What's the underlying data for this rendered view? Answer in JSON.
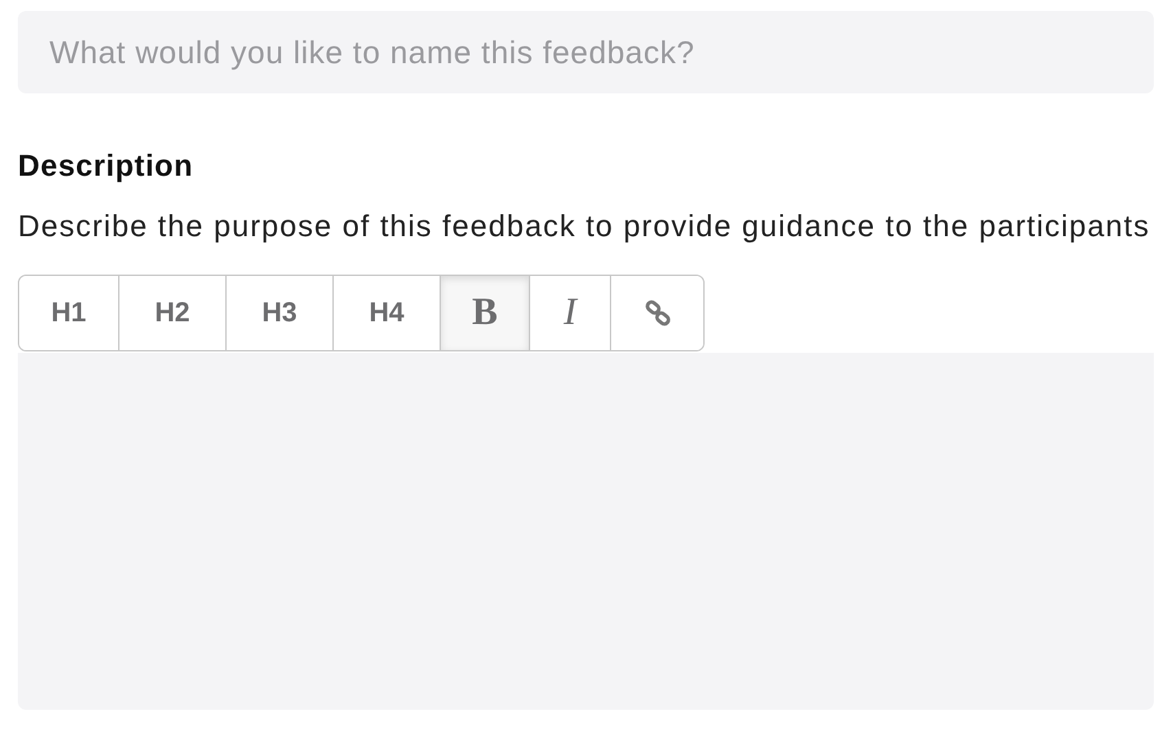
{
  "title_field": {
    "placeholder": "What would you like to name this feedback?"
  },
  "description": {
    "heading": "Description",
    "hint": "Describe the purpose of this feedback to provide guidance to the participants"
  },
  "toolbar": [
    {
      "kind": "heading",
      "label": "H1",
      "active": false
    },
    {
      "kind": "heading",
      "label": "H2",
      "active": false
    },
    {
      "kind": "heading",
      "label": "H3",
      "active": false
    },
    {
      "kind": "heading",
      "label": "H4",
      "active": false
    },
    {
      "kind": "bold",
      "label": "B",
      "active": true
    },
    {
      "kind": "italic",
      "label": "I",
      "active": false
    },
    {
      "kind": "link",
      "active": false
    }
  ],
  "editor": {
    "kind": "empty"
  }
}
